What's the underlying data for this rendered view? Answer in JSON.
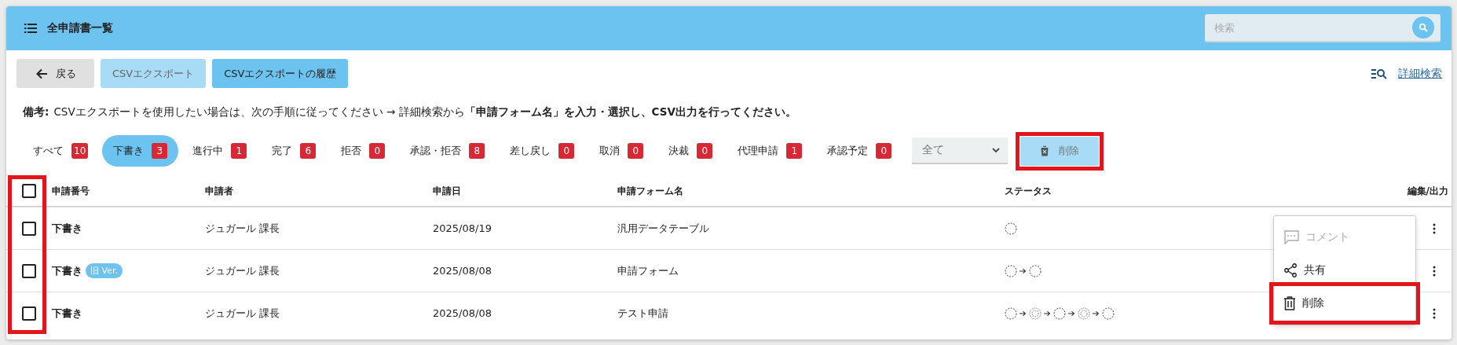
{
  "header": {
    "title": "全申請書一覧",
    "search": {
      "placeholder": "検索"
    }
  },
  "toolbar": {
    "buttons": [
      {
        "label": "戻る",
        "kind": "back",
        "disabled": false
      },
      {
        "label": "CSVエクスポート",
        "kind": "plain",
        "disabled": true
      },
      {
        "label": "CSVエクスポートの履歴",
        "kind": "plain",
        "disabled": false
      }
    ],
    "advanced_search": "詳細検索"
  },
  "note": {
    "label": "備考:",
    "text": "CSVエクスポートを使用したい場合は、次の手順に従ってください → 詳細検索から**「申請フォーム名」を入力・選択し、CSV出力を行ってください。**"
  },
  "filter_tabs": [
    {
      "label": "すべて",
      "count": "10",
      "selected": false
    },
    {
      "label": "下書き",
      "count": "3",
      "selected": true
    },
    {
      "label": "進行中",
      "count": "1",
      "selected": false
    },
    {
      "label": "完了",
      "count": "6",
      "selected": false
    },
    {
      "label": "拒否",
      "count": "0",
      "selected": false
    },
    {
      "label": "承認・拒否",
      "count": "8",
      "selected": false
    },
    {
      "label": "差し戻し",
      "count": "0",
      "selected": false
    },
    {
      "label": "取消",
      "count": "0",
      "selected": false
    },
    {
      "label": "決裁",
      "count": "0",
      "selected": false
    },
    {
      "label": "代理申請",
      "count": "1",
      "selected": false
    },
    {
      "label": "承認予定",
      "count": "0",
      "selected": false
    }
  ],
  "filter_select": {
    "value": "全て"
  },
  "delete_button": {
    "label": "削除",
    "disabled": true
  },
  "table": {
    "columns": [
      "申請番号",
      "申請者",
      "申請日",
      "申請フォーム名",
      "ステータス",
      "編集/出力"
    ],
    "header_checked": false,
    "rows": [
      {
        "checked": false,
        "number": "下書き",
        "applicant": "ジュガール 課長",
        "date": "2025/08/19",
        "form": "汎用データテーブル",
        "steps": [
          {
            "kind": "single"
          }
        ]
      },
      {
        "checked": false,
        "number": "下書き",
        "badge": "旧 Ver.",
        "applicant": "ジュガール 課長",
        "date": "2025/08/08",
        "form": "申請フォーム",
        "steps": [
          {
            "kind": "single"
          },
          {
            "kind": "single"
          }
        ]
      },
      {
        "checked": false,
        "number": "下書き",
        "applicant": "ジュガール 課長",
        "date": "2025/08/08",
        "form": "テスト申請",
        "steps": [
          {
            "kind": "single"
          },
          {
            "kind": "double"
          },
          {
            "kind": "single"
          },
          {
            "kind": "double"
          },
          {
            "kind": "single"
          }
        ]
      }
    ]
  },
  "context_menu": [
    {
      "label": "コメント",
      "kind": "comment",
      "disabled": true
    },
    {
      "label": "共有",
      "kind": "share",
      "disabled": false
    },
    {
      "label": "削除",
      "kind": "delete",
      "disabled": false
    }
  ]
}
